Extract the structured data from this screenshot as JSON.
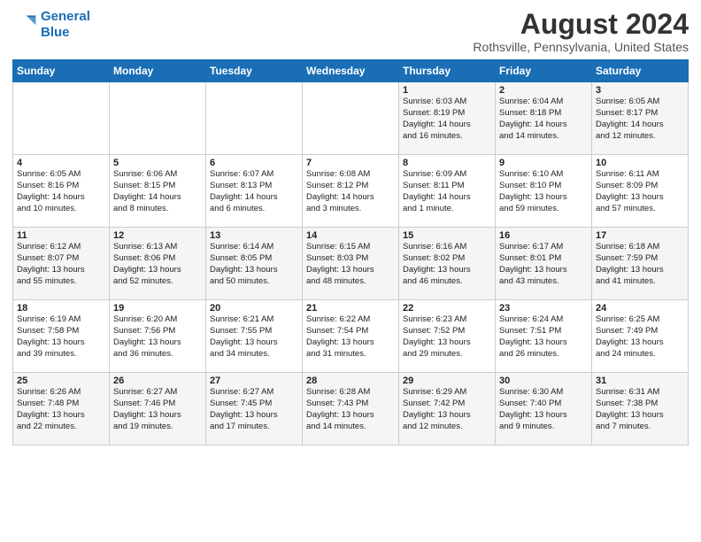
{
  "logo": {
    "line1": "General",
    "line2": "Blue"
  },
  "header": {
    "month": "August 2024",
    "location": "Rothsville, Pennsylvania, United States"
  },
  "weekdays": [
    "Sunday",
    "Monday",
    "Tuesday",
    "Wednesday",
    "Thursday",
    "Friday",
    "Saturday"
  ],
  "weeks": [
    [
      {
        "day": "",
        "info": ""
      },
      {
        "day": "",
        "info": ""
      },
      {
        "day": "",
        "info": ""
      },
      {
        "day": "",
        "info": ""
      },
      {
        "day": "1",
        "info": "Sunrise: 6:03 AM\nSunset: 8:19 PM\nDaylight: 14 hours\nand 16 minutes."
      },
      {
        "day": "2",
        "info": "Sunrise: 6:04 AM\nSunset: 8:18 PM\nDaylight: 14 hours\nand 14 minutes."
      },
      {
        "day": "3",
        "info": "Sunrise: 6:05 AM\nSunset: 8:17 PM\nDaylight: 14 hours\nand 12 minutes."
      }
    ],
    [
      {
        "day": "4",
        "info": "Sunrise: 6:05 AM\nSunset: 8:16 PM\nDaylight: 14 hours\nand 10 minutes."
      },
      {
        "day": "5",
        "info": "Sunrise: 6:06 AM\nSunset: 8:15 PM\nDaylight: 14 hours\nand 8 minutes."
      },
      {
        "day": "6",
        "info": "Sunrise: 6:07 AM\nSunset: 8:13 PM\nDaylight: 14 hours\nand 6 minutes."
      },
      {
        "day": "7",
        "info": "Sunrise: 6:08 AM\nSunset: 8:12 PM\nDaylight: 14 hours\nand 3 minutes."
      },
      {
        "day": "8",
        "info": "Sunrise: 6:09 AM\nSunset: 8:11 PM\nDaylight: 14 hours\nand 1 minute."
      },
      {
        "day": "9",
        "info": "Sunrise: 6:10 AM\nSunset: 8:10 PM\nDaylight: 13 hours\nand 59 minutes."
      },
      {
        "day": "10",
        "info": "Sunrise: 6:11 AM\nSunset: 8:09 PM\nDaylight: 13 hours\nand 57 minutes."
      }
    ],
    [
      {
        "day": "11",
        "info": "Sunrise: 6:12 AM\nSunset: 8:07 PM\nDaylight: 13 hours\nand 55 minutes."
      },
      {
        "day": "12",
        "info": "Sunrise: 6:13 AM\nSunset: 8:06 PM\nDaylight: 13 hours\nand 52 minutes."
      },
      {
        "day": "13",
        "info": "Sunrise: 6:14 AM\nSunset: 8:05 PM\nDaylight: 13 hours\nand 50 minutes."
      },
      {
        "day": "14",
        "info": "Sunrise: 6:15 AM\nSunset: 8:03 PM\nDaylight: 13 hours\nand 48 minutes."
      },
      {
        "day": "15",
        "info": "Sunrise: 6:16 AM\nSunset: 8:02 PM\nDaylight: 13 hours\nand 46 minutes."
      },
      {
        "day": "16",
        "info": "Sunrise: 6:17 AM\nSunset: 8:01 PM\nDaylight: 13 hours\nand 43 minutes."
      },
      {
        "day": "17",
        "info": "Sunrise: 6:18 AM\nSunset: 7:59 PM\nDaylight: 13 hours\nand 41 minutes."
      }
    ],
    [
      {
        "day": "18",
        "info": "Sunrise: 6:19 AM\nSunset: 7:58 PM\nDaylight: 13 hours\nand 39 minutes."
      },
      {
        "day": "19",
        "info": "Sunrise: 6:20 AM\nSunset: 7:56 PM\nDaylight: 13 hours\nand 36 minutes."
      },
      {
        "day": "20",
        "info": "Sunrise: 6:21 AM\nSunset: 7:55 PM\nDaylight: 13 hours\nand 34 minutes."
      },
      {
        "day": "21",
        "info": "Sunrise: 6:22 AM\nSunset: 7:54 PM\nDaylight: 13 hours\nand 31 minutes."
      },
      {
        "day": "22",
        "info": "Sunrise: 6:23 AM\nSunset: 7:52 PM\nDaylight: 13 hours\nand 29 minutes."
      },
      {
        "day": "23",
        "info": "Sunrise: 6:24 AM\nSunset: 7:51 PM\nDaylight: 13 hours\nand 26 minutes."
      },
      {
        "day": "24",
        "info": "Sunrise: 6:25 AM\nSunset: 7:49 PM\nDaylight: 13 hours\nand 24 minutes."
      }
    ],
    [
      {
        "day": "25",
        "info": "Sunrise: 6:26 AM\nSunset: 7:48 PM\nDaylight: 13 hours\nand 22 minutes."
      },
      {
        "day": "26",
        "info": "Sunrise: 6:27 AM\nSunset: 7:46 PM\nDaylight: 13 hours\nand 19 minutes."
      },
      {
        "day": "27",
        "info": "Sunrise: 6:27 AM\nSunset: 7:45 PM\nDaylight: 13 hours\nand 17 minutes."
      },
      {
        "day": "28",
        "info": "Sunrise: 6:28 AM\nSunset: 7:43 PM\nDaylight: 13 hours\nand 14 minutes."
      },
      {
        "day": "29",
        "info": "Sunrise: 6:29 AM\nSunset: 7:42 PM\nDaylight: 13 hours\nand 12 minutes."
      },
      {
        "day": "30",
        "info": "Sunrise: 6:30 AM\nSunset: 7:40 PM\nDaylight: 13 hours\nand 9 minutes."
      },
      {
        "day": "31",
        "info": "Sunrise: 6:31 AM\nSunset: 7:38 PM\nDaylight: 13 hours\nand 7 minutes."
      }
    ]
  ]
}
